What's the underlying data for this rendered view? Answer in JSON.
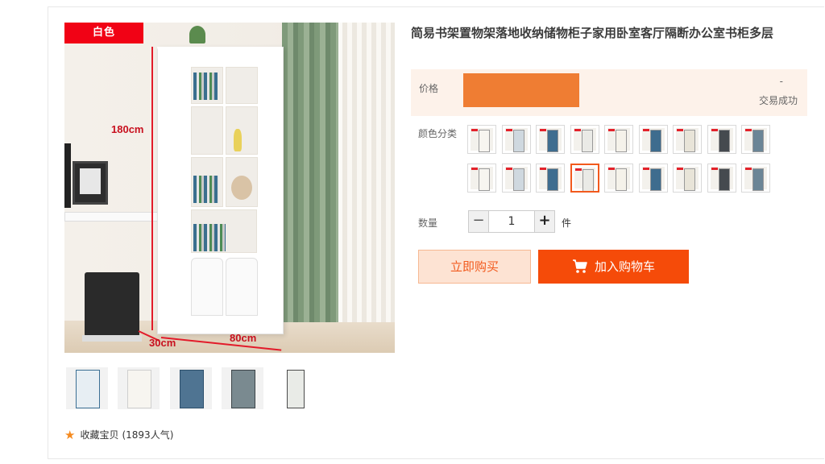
{
  "product": {
    "title": "简易书架置物架落地收纳储物柜子家用卧室客厅隔断办公室书柜多层",
    "main_image": {
      "color_tag": "白色",
      "dimensions": {
        "height": "180cm",
        "depth": "30cm",
        "width": "80cm"
      }
    },
    "thumbnails": [
      "thumbnail-1",
      "thumbnail-2",
      "thumbnail-3",
      "thumbnail-4",
      "thumbnail-5"
    ],
    "favorite": {
      "label": "收藏宝贝",
      "count_text": "(1893人气)",
      "icon": "star-icon",
      "icon_color": "#f58a1f"
    }
  },
  "price": {
    "label": "价格",
    "value_redacted": true,
    "bar_color": "#ef7d33",
    "dash": "-",
    "sales_label": "交易成功"
  },
  "color_options": {
    "label": "颜色分类",
    "swatches_count": 18,
    "selected_index": 12,
    "selected_border_color": "#f25a1d"
  },
  "quantity": {
    "label": "数量",
    "value": "1",
    "unit": "件",
    "minus": "−",
    "plus": "+"
  },
  "actions": {
    "buy_now": "立即购买",
    "add_to_cart": "加入购物车",
    "cart_icon": "cart-icon",
    "accent": "#f54b09"
  }
}
